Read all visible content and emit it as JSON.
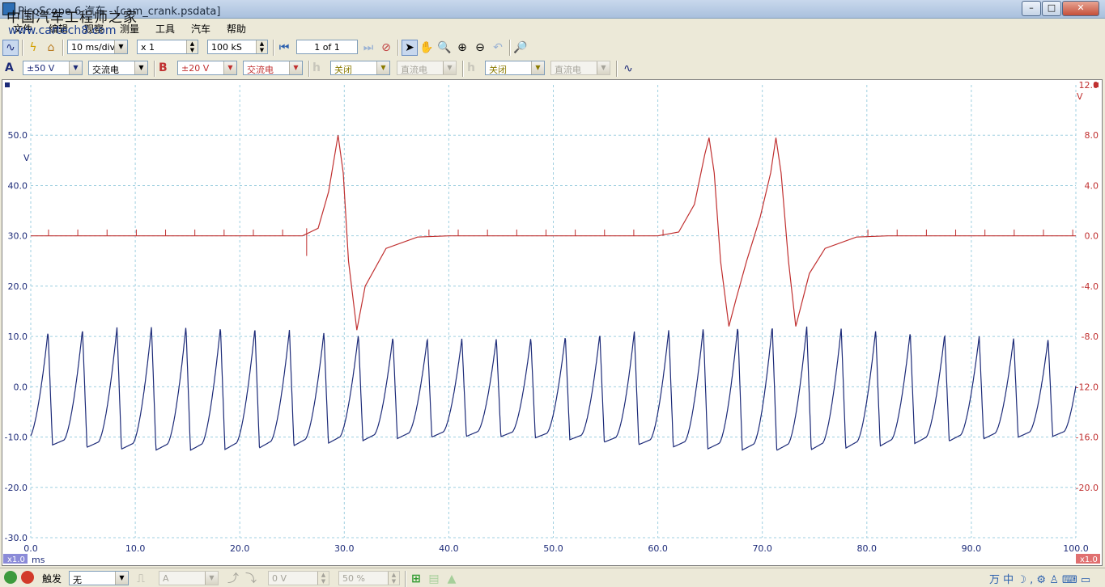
{
  "window": {
    "title": "PicoScope 6 汽车 - [cam_crank.psdata]",
    "watermark": "中国汽车工程师之家",
    "watermark_url": "www.cartech8.com",
    "buttons": {
      "minimize": "–",
      "maximize": "□",
      "close": "✕"
    }
  },
  "menu": [
    "文件",
    "编辑",
    "观察",
    "测量",
    "工具",
    "汽车",
    "帮助"
  ],
  "toolbar": {
    "timebase": "10 ms/div",
    "zoom": "x 1",
    "samples": "100 kS",
    "buffer": "1 of 1"
  },
  "channels": {
    "a": {
      "name": "A",
      "range": "±50 V",
      "coupling": "交流电",
      "color": "#1c2a78"
    },
    "b": {
      "name": "B",
      "range": "±20 V",
      "coupling": "交流电",
      "color": "#c03030"
    },
    "c": {
      "state": "关闭",
      "coupling": "直流电"
    },
    "d": {
      "state": "关闭",
      "coupling": "直流电"
    }
  },
  "bottom": {
    "trigger_label": "触发",
    "trigger_mode": "无",
    "trigger_channel": "A",
    "threshold": "0 V",
    "pretrigger": "50 %"
  },
  "axes": {
    "left_unit": "V",
    "right_unit": "V",
    "x_unit": "ms",
    "left_zoom": "x1.0",
    "right_zoom": "x1.0",
    "left_ticks": [
      "50.0",
      "40.0",
      "30.0",
      "20.0",
      "10.0",
      "0.0",
      "-10.0",
      "-20.0",
      "-30.0"
    ],
    "right_ticks": [
      "12.0",
      "8.0",
      "4.0",
      "0.0",
      "-4.0",
      "-8.0",
      "-12.0",
      "-16.0",
      "-20.0"
    ],
    "x_ticks": [
      "0.0",
      "10.0",
      "20.0",
      "30.0",
      "40.0",
      "50.0",
      "60.0",
      "70.0",
      "80.0",
      "90.0",
      "100.0"
    ]
  },
  "chart_data": {
    "type": "line",
    "x_range": [
      0,
      100
    ],
    "left_ylim": [
      -30,
      60
    ],
    "right_ylim": [
      -24,
      12
    ],
    "grid": true,
    "series": [
      {
        "name": "A",
        "axis": "left",
        "color": "#1c2a78",
        "oscillation": {
          "period_ms": 3.3,
          "amplitude_v": 10.5,
          "offset_v": 0.3
        }
      },
      {
        "name": "B",
        "axis": "right",
        "color": "#c03030",
        "points": [
          [
            0,
            0
          ],
          [
            26,
            0
          ],
          [
            27.5,
            0.6
          ],
          [
            28.5,
            3.5
          ],
          [
            29.4,
            8
          ],
          [
            29.9,
            5
          ],
          [
            30.4,
            -2
          ],
          [
            31.2,
            -7.5
          ],
          [
            32,
            -4
          ],
          [
            34,
            -1
          ],
          [
            37,
            -0.1
          ],
          [
            40,
            0
          ],
          [
            60,
            0
          ],
          [
            62,
            0.3
          ],
          [
            63.5,
            2.5
          ],
          [
            64.5,
            6.5
          ],
          [
            64.9,
            7.8
          ],
          [
            65.4,
            5
          ],
          [
            66,
            -2
          ],
          [
            66.8,
            -7.2
          ],
          [
            67.5,
            -5
          ],
          [
            68.5,
            -2
          ],
          [
            69.8,
            1.5
          ],
          [
            70.8,
            5
          ],
          [
            71.3,
            7.8
          ],
          [
            71.8,
            5
          ],
          [
            72.5,
            -2
          ],
          [
            73.2,
            -7.2
          ],
          [
            74.5,
            -3
          ],
          [
            76,
            -1
          ],
          [
            79,
            -0.1
          ],
          [
            82,
            0
          ],
          [
            100,
            0
          ]
        ]
      }
    ]
  }
}
